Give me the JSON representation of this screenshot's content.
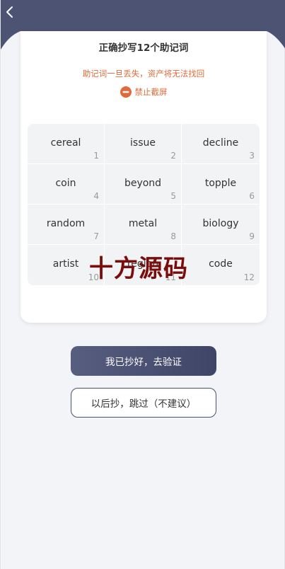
{
  "header": {
    "back_icon": "chevron-left-icon",
    "color": "#4c5373"
  },
  "card": {
    "title": "正确抄写12个助记词",
    "warning": "助记词一旦丢失，资产将无法找回",
    "screenshot_notice": "禁止截屏",
    "notice_icon": "no-entry-icon",
    "accent_color": "#e06a3a"
  },
  "mnemonic": [
    {
      "word": "cereal",
      "index": "1"
    },
    {
      "word": "issue",
      "index": "2"
    },
    {
      "word": "decline",
      "index": "3"
    },
    {
      "word": "coin",
      "index": "4"
    },
    {
      "word": "beyond",
      "index": "5"
    },
    {
      "word": "topple",
      "index": "6"
    },
    {
      "word": "random",
      "index": "7"
    },
    {
      "word": "metal",
      "index": "8"
    },
    {
      "word": "biology",
      "index": "9"
    },
    {
      "word": "artist",
      "index": "10"
    },
    {
      "word": "region",
      "index": "11"
    },
    {
      "word": "code",
      "index": "12"
    }
  ],
  "watermark": "十方源码",
  "buttons": {
    "verify": "我已抄好，去验证",
    "skip": "以后抄，跳过（不建议）"
  }
}
